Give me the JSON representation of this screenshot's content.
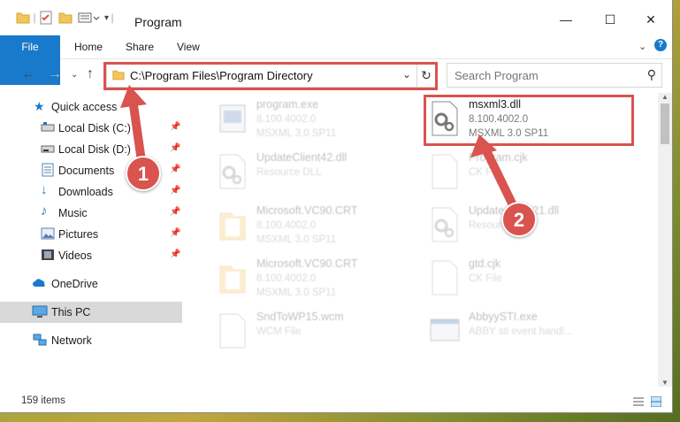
{
  "window": {
    "title": "Program",
    "minimize": "—",
    "maximize": "☐",
    "close": "✕"
  },
  "ribbon": {
    "tabs": [
      "File",
      "Home",
      "Share",
      "View"
    ],
    "help": "?"
  },
  "address": {
    "path": "C:\\Program Files\\Program Directory",
    "search_placeholder": "Search Program"
  },
  "sidebar": {
    "items": [
      {
        "label": "Quick access",
        "icon": "star-icon"
      },
      {
        "label": "Local Disk (C:)",
        "icon": "drive-icon",
        "pinned": true
      },
      {
        "label": "Local Disk (D:)",
        "icon": "drive-icon",
        "pinned": true
      },
      {
        "label": "Documents",
        "icon": "documents-icon",
        "pinned": true
      },
      {
        "label": "Downloads",
        "icon": "download-icon",
        "pinned": true
      },
      {
        "label": "Music",
        "icon": "music-icon",
        "pinned": true
      },
      {
        "label": "Pictures",
        "icon": "pictures-icon",
        "pinned": true
      },
      {
        "label": "Videos",
        "icon": "videos-icon",
        "pinned": true
      },
      {
        "label": "OneDrive",
        "icon": "cloud-icon"
      },
      {
        "label": "This PC",
        "icon": "computer-icon",
        "selected": true
      },
      {
        "label": "Network",
        "icon": "network-icon"
      }
    ]
  },
  "files": [
    {
      "name": "program.exe",
      "line1": "8.100.4002.0",
      "line2": "MSXML 3.0 SP11",
      "icon": "exe-icon"
    },
    {
      "name": "msxml3.dll",
      "line1": "8.100.4002.0",
      "line2": "MSXML 3.0 SP11",
      "icon": "dll-gear-icon"
    },
    {
      "name": "UpdateClient42.dll",
      "line1": "Resource DLL",
      "line2": "",
      "icon": "dll-gear-icon"
    },
    {
      "name": "Program.cjk",
      "line1": "CK File",
      "line2": "",
      "icon": "file-icon"
    },
    {
      "name": "Microsoft.VC90.CRT",
      "line1": "8.100.4002.0",
      "line2": "MSXML 3.0 SP11",
      "icon": "folder-icon"
    },
    {
      "name": "UpdateClient21.dll",
      "line1": "Resource DLL",
      "line2": "",
      "icon": "dll-gear-icon"
    },
    {
      "name": "Microsoft.VC90.CRT",
      "line1": "8.100.4002.0",
      "line2": "MSXML 3.0 SP11",
      "icon": "folder-icon"
    },
    {
      "name": "gtd.cjk",
      "line1": "CK File",
      "line2": "",
      "icon": "file-icon"
    },
    {
      "name": "SndToWP15.wcm",
      "line1": "WCM File",
      "line2": "",
      "icon": "file-icon"
    },
    {
      "name": "AbbyySTI.exe",
      "line1": "ABBY sti event handl...",
      "line2": "",
      "icon": "exe-icon"
    }
  ],
  "status": {
    "item_count": "159 items"
  },
  "annotations": {
    "step1": "1",
    "step2": "2",
    "color": "#d9534f"
  }
}
